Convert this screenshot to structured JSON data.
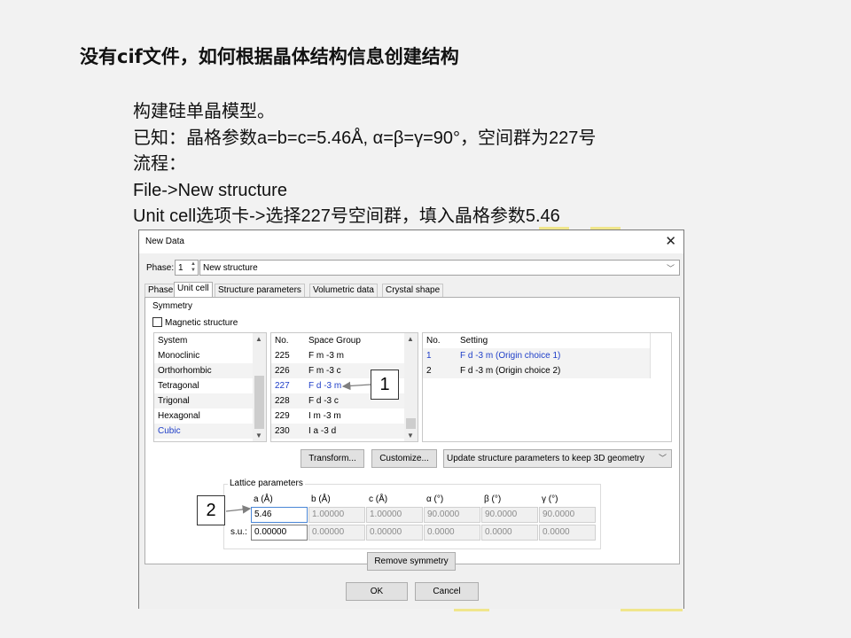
{
  "slide": {
    "title": "没有cif文件，如何根据晶体结构信息创建结构",
    "lines": [
      "构建硅单晶模型。",
      "已知：晶格参数a=b=c=5.46Å, α=β=γ=90°，空间群为227号",
      "流程：",
      "File->New structure",
      "Unit cell选项卡->选择227号空间群，填入晶格参数5.46"
    ]
  },
  "dialog": {
    "title": "New Data",
    "close_glyph": "✕",
    "phase_label": "Phase:",
    "phase_number": "1",
    "phase_name": "New structure",
    "tabs": [
      "Phase",
      "Unit cell",
      "Structure parameters",
      "Volumetric data",
      "Crystal shape"
    ],
    "active_tab": "Unit cell",
    "symmetry_label": "Symmetry",
    "magnetic_label": "Magnetic structure",
    "system_list": {
      "header": "System",
      "items": [
        "Monoclinic",
        "Orthorhombic",
        "Tetragonal",
        "Trigonal",
        "Hexagonal",
        "Cubic"
      ],
      "selected": "Cubic"
    },
    "spacegroup_list": {
      "headers": [
        "No.",
        "Space Group"
      ],
      "rows": [
        {
          "no": "225",
          "name": "F m -3 m"
        },
        {
          "no": "226",
          "name": "F m -3 c"
        },
        {
          "no": "227",
          "name": "F d -3 m"
        },
        {
          "no": "228",
          "name": "F d -3 c"
        },
        {
          "no": "229",
          "name": "I m -3 m"
        },
        {
          "no": "230",
          "name": "I a -3 d"
        }
      ],
      "selected": "227"
    },
    "setting_list": {
      "headers": [
        "No.",
        "Setting"
      ],
      "rows": [
        {
          "no": "1",
          "name": "F d -3 m (Origin choice 1)"
        },
        {
          "no": "2",
          "name": "F d -3 m (Origin choice 2)"
        }
      ],
      "selected": "1"
    },
    "transform_label": "Transform...",
    "customize_label": "Customize...",
    "update_combo": "Update structure parameters to keep 3D geometry",
    "lattice": {
      "title": "Lattice parameters",
      "headers": [
        "a (Å)",
        "b (Å)",
        "c (Å)",
        "α (°)",
        "β (°)",
        "γ (°)"
      ],
      "values": [
        "5.46",
        "1.00000",
        "1.00000",
        "90.0000",
        "90.0000",
        "90.0000"
      ],
      "su_label": "s.u.:",
      "su_values": [
        "0.00000",
        "0.00000",
        "0.00000",
        "0.0000",
        "0.0000",
        "0.0000"
      ]
    },
    "remove_symmetry_label": "Remove symmetry",
    "ok_label": "OK",
    "cancel_label": "Cancel"
  },
  "callouts": [
    "1",
    "2"
  ],
  "colors": {
    "selected_text": "#1e3ec8",
    "arrow": "#7f7f7f"
  }
}
